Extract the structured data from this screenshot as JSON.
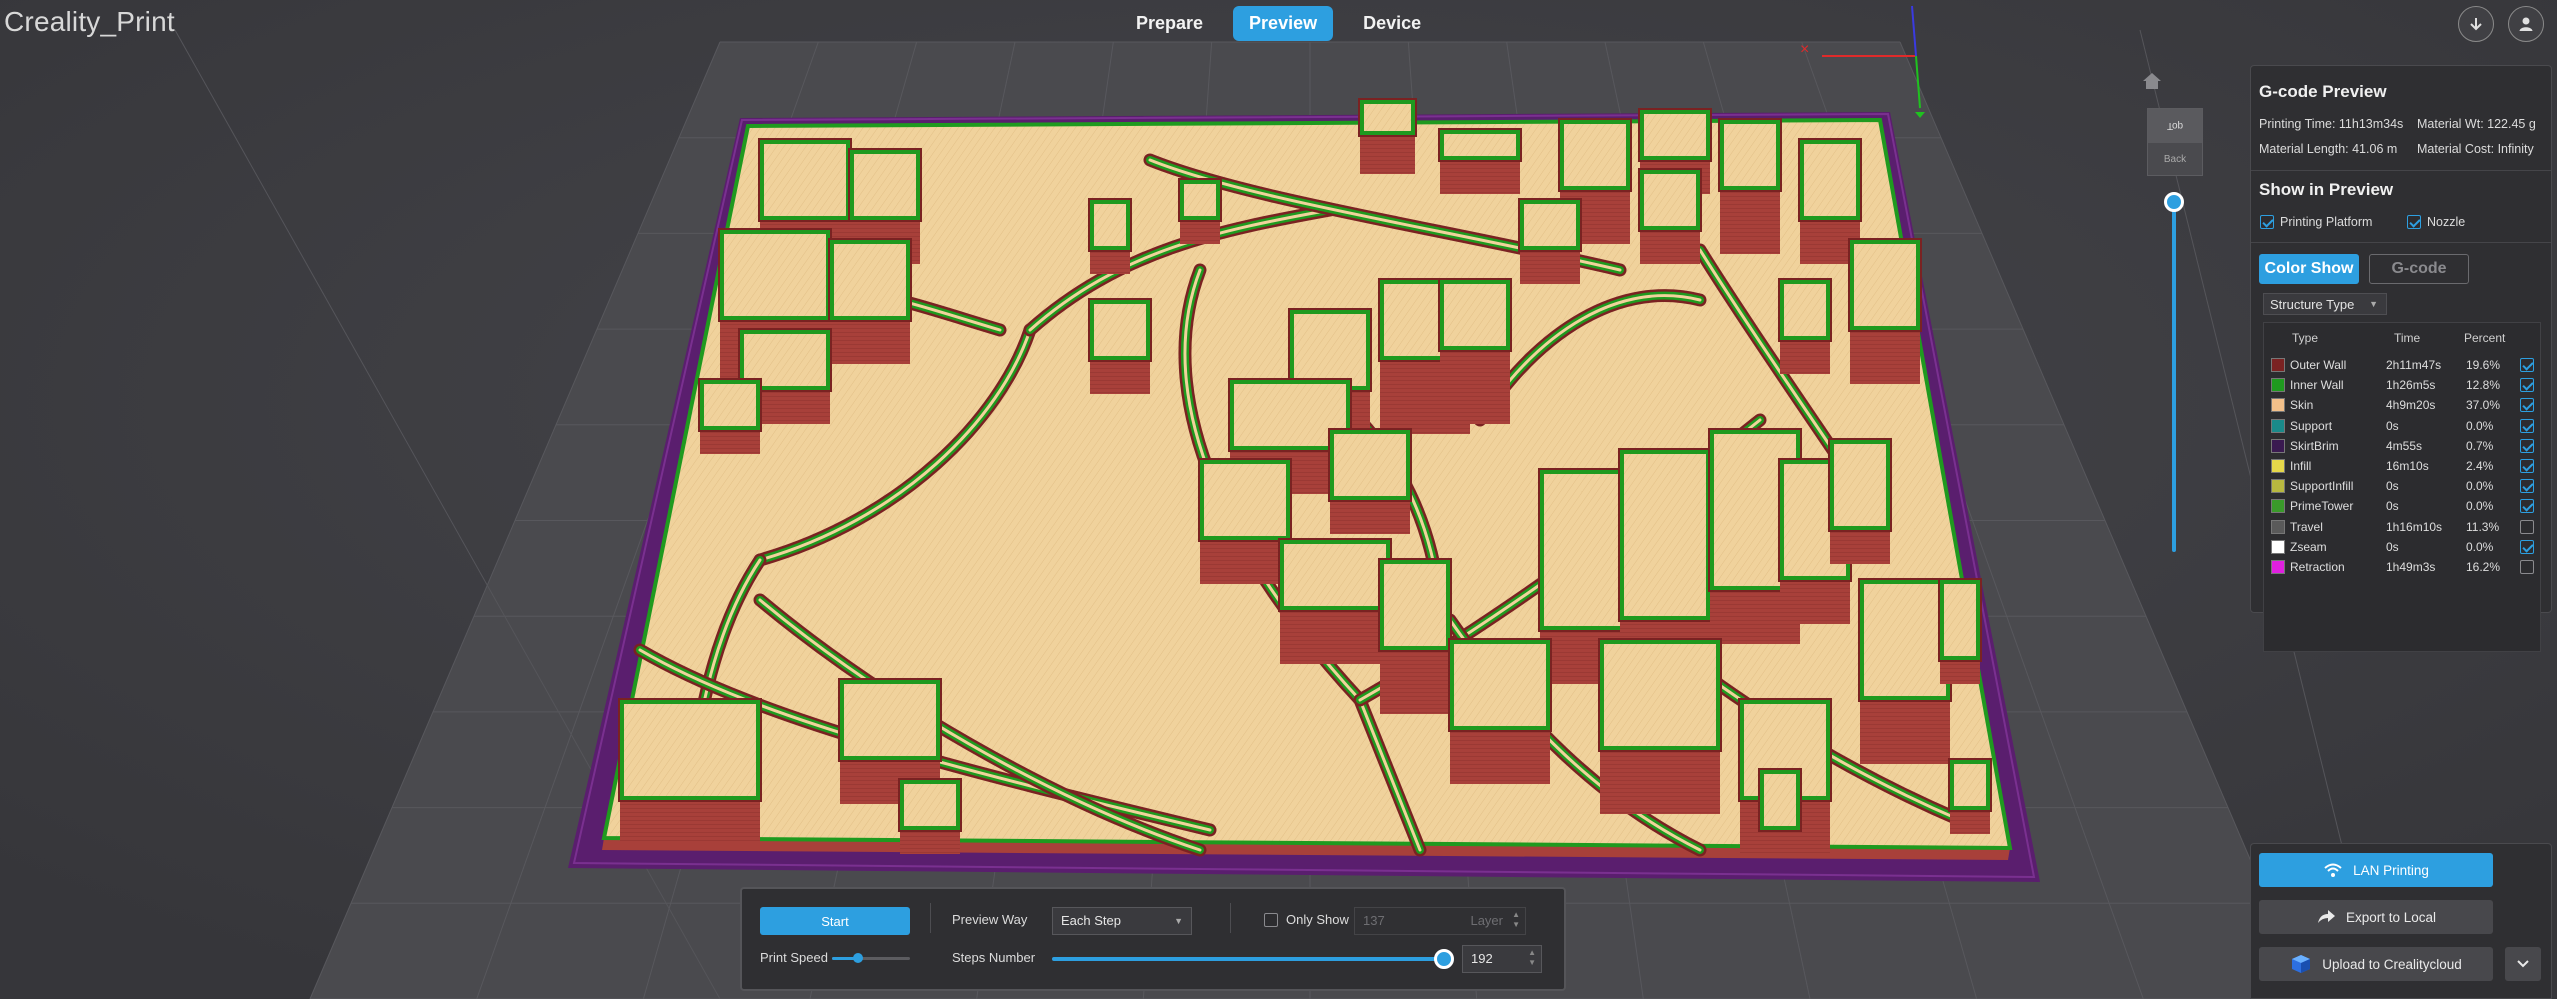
{
  "app": {
    "title": "Creality_Print"
  },
  "nav": {
    "tabs": [
      {
        "label": "Prepare",
        "active": false
      },
      {
        "label": "Preview",
        "active": true
      },
      {
        "label": "Device",
        "active": false
      }
    ],
    "icons": [
      "download-icon",
      "user-icon"
    ]
  },
  "view_cube": {
    "top_label": "Top",
    "back_label": "Back"
  },
  "gcode_preview": {
    "title": "G-code Preview",
    "printing_time": "Printing Time: 11h13m34s",
    "material_weight": "Material Wt: 122.45 g",
    "material_length": "Material Length: 41.06 m",
    "material_cost": "Material Cost: Infinity",
    "show_title": "Show in Preview",
    "printing_platform_label": "Printing Platform",
    "printing_platform_checked": true,
    "nozzle_label": "Nozzle",
    "nozzle_checked": true,
    "color_show_label": "Color Show",
    "gcode_label": "G-code",
    "structure_select": "Structure Type",
    "columns": {
      "type": "Type",
      "time": "Time",
      "percent": "Percent"
    },
    "rows": [
      {
        "name": "Outer Wall",
        "time": "2h11m47s",
        "percent": "19.6%",
        "color": "#7a2222",
        "visible": true
      },
      {
        "name": "Inner Wall",
        "time": "1h26m5s",
        "percent": "12.8%",
        "color": "#1f9a1f",
        "visible": true
      },
      {
        "name": "Skin",
        "time": "4h9m20s",
        "percent": "37.0%",
        "color": "#f2c08a",
        "visible": true
      },
      {
        "name": "Support",
        "time": "0s",
        "percent": "0.0%",
        "color": "#1a8a8a",
        "visible": true
      },
      {
        "name": "SkirtBrim",
        "time": "4m55s",
        "percent": "0.7%",
        "color": "#3a1a50",
        "visible": true
      },
      {
        "name": "Infill",
        "time": "16m10s",
        "percent": "2.4%",
        "color": "#e6d84a",
        "visible": true
      },
      {
        "name": "SupportInfill",
        "time": "0s",
        "percent": "0.0%",
        "color": "#b8b840",
        "visible": true
      },
      {
        "name": "PrimeTower",
        "time": "0s",
        "percent": "0.0%",
        "color": "#3a9a2a",
        "visible": true
      },
      {
        "name": "Travel",
        "time": "1h16m10s",
        "percent": "11.3%",
        "color": "#5a5a5a",
        "visible": false
      },
      {
        "name": "Zseam",
        "time": "0s",
        "percent": "0.0%",
        "color": "#ffffff",
        "visible": true
      },
      {
        "name": "Retraction",
        "time": "1h49m3s",
        "percent": "16.2%",
        "color": "#e020e0",
        "visible": false
      }
    ]
  },
  "export": {
    "lan_printing": "LAN Printing",
    "export_local": "Export to Local",
    "upload_cloud": "Upload to Crealitycloud"
  },
  "playback": {
    "start_label": "Start",
    "print_speed_label": "Print Speed",
    "print_speed_level": 0.33,
    "preview_way_label": "Preview Way",
    "preview_way_value": "Each Step",
    "only_show_label": "Only Show",
    "only_show_checked": false,
    "layer_value": "137",
    "layer_label": "Layer",
    "steps_label": "Steps Number",
    "steps_value": "192",
    "steps_level": 1.0
  },
  "colors": {
    "accent": "#2d9fe0",
    "outer_wall": "#a8403a",
    "skin": "#f0d29c",
    "inner_wall": "#1f9a1f",
    "brim": "#5a1e6e"
  }
}
